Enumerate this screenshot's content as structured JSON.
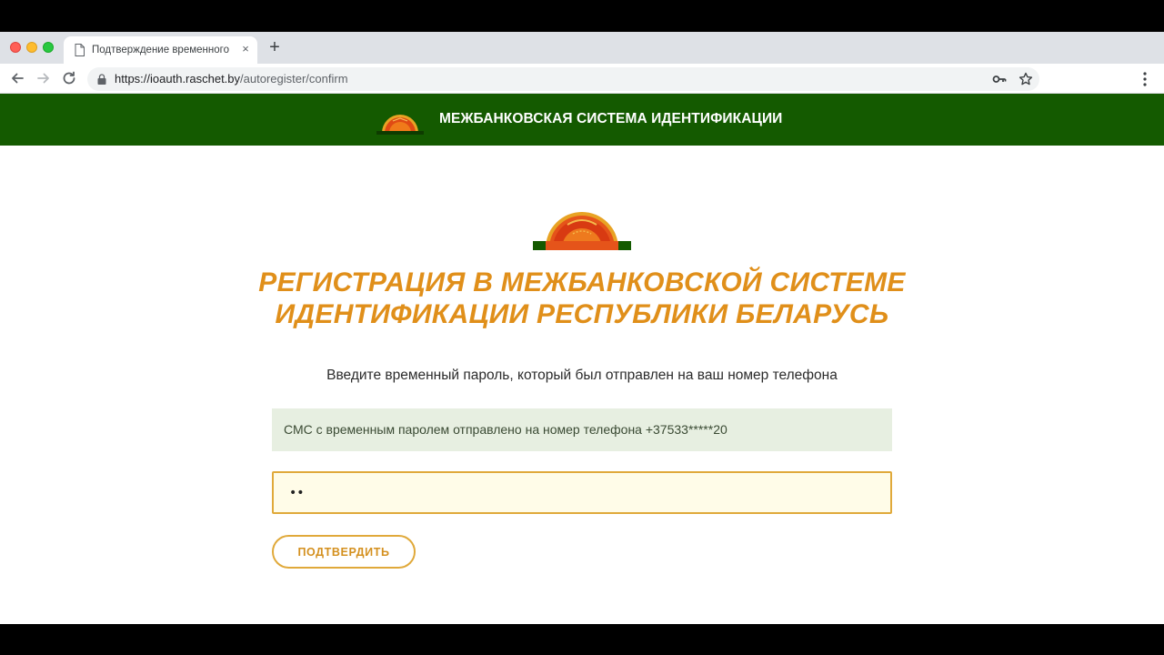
{
  "browser": {
    "tab": {
      "title": "Подтверждение временного",
      "close_label": "×"
    },
    "new_tab_label": "+",
    "url": {
      "host": "https://ioauth.raschet.by",
      "path": "/autoregister/confirm"
    }
  },
  "header": {
    "title": "МЕЖБАНКОВСКАЯ СИСТЕМА ИДЕНТИФИКАЦИИ"
  },
  "main": {
    "title_line1": "РЕГИСТРАЦИЯ В МЕЖБАНКОВСКОЙ СИСТЕМЕ",
    "title_line2": "ИДЕНТИФИКАЦИИ РЕСПУБЛИКИ БЕЛАРУСЬ",
    "instruction": "Введите временный пароль, который был отправлен на ваш номер телефона",
    "sms_notice": "СМС с временным паролем отправлено на номер телефона +37533*****20",
    "password_value": "••",
    "confirm_button": "ПОДТВЕРДИТЬ"
  },
  "colors": {
    "header_green": "#145a00",
    "accent_orange": "#e08f1a",
    "notice_bg": "#e7efe1",
    "input_bg": "#fffce8"
  },
  "icons": [
    "document-icon",
    "close-icon",
    "plus-icon",
    "back-arrow-icon",
    "forward-arrow-icon",
    "reload-icon",
    "lock-icon",
    "key-icon",
    "star-icon",
    "kebab-menu-icon",
    "logo-icon"
  ]
}
